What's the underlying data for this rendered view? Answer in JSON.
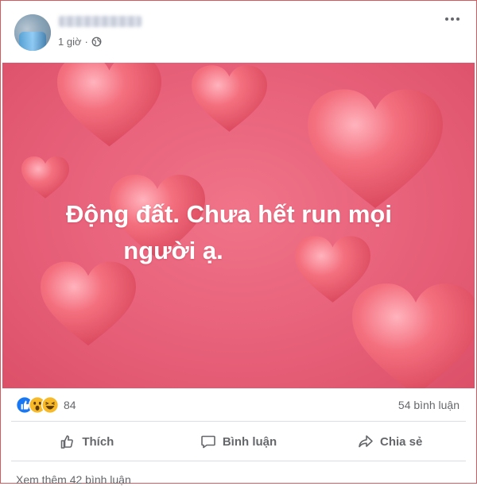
{
  "post": {
    "time": "1 giờ",
    "separator": "·",
    "text_line1": "Động đất. Chưa hết run mọi",
    "text_line2": "người ạ.",
    "background_color": "#e76079"
  },
  "stats": {
    "reaction_count": "84",
    "reaction_icons": [
      "like-icon",
      "wow-icon",
      "haha-icon"
    ],
    "comments": "54 bình luận"
  },
  "actions": {
    "like": "Thích",
    "comment": "Bình luận",
    "share": "Chia sẻ"
  },
  "footer": {
    "more_comments": "Xem thêm 42 bình luận"
  }
}
